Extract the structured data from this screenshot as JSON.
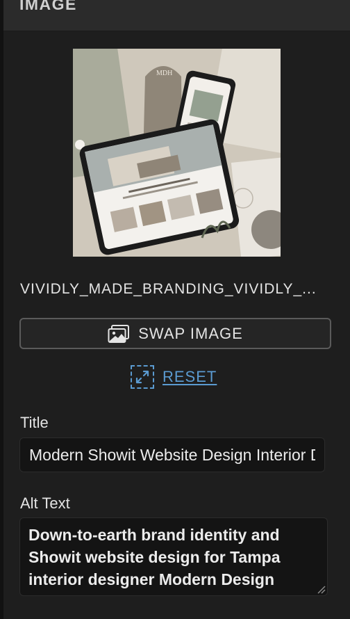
{
  "panel": {
    "title": "IMAGE"
  },
  "image": {
    "filename": "VIVIDLY_MADE_BRANDING_VIVIDLY_..."
  },
  "actions": {
    "swap_label": "SWAP IMAGE",
    "swap_icon": "image-icon",
    "reset_label": "RESET",
    "reset_icon": "expand-arrows-icon"
  },
  "fields": {
    "title_label": "Title",
    "title_value": "Modern Showit Website Design Interior Designer",
    "alt_label": "Alt Text",
    "alt_value": "Down-to-earth brand identity and Showit website design for Tampa interior designer Modern Design Home, created by Vividly Made Branding."
  },
  "colors": {
    "panel_bg": "#1e1e1e",
    "header_bg": "#2b2b2b",
    "link_blue": "#5b9bd1",
    "input_bg": "#141414"
  }
}
